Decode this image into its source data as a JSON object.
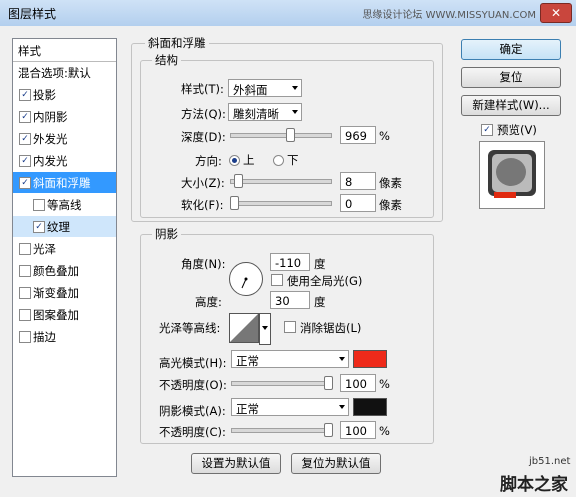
{
  "window": {
    "title": "图层样式",
    "watermark": "思缘设计论坛 WWW.MISSYUAN.COM",
    "close": "✕"
  },
  "sidebar": {
    "header": "样式",
    "items": [
      {
        "label": "混合选项:默认",
        "checkbox": false,
        "checked": false,
        "selected": false,
        "sub": false
      },
      {
        "label": "投影",
        "checkbox": true,
        "checked": true,
        "selected": false,
        "sub": false
      },
      {
        "label": "内阴影",
        "checkbox": true,
        "checked": true,
        "selected": false,
        "sub": false
      },
      {
        "label": "外发光",
        "checkbox": true,
        "checked": true,
        "selected": false,
        "sub": false
      },
      {
        "label": "内发光",
        "checkbox": true,
        "checked": true,
        "selected": false,
        "sub": false
      },
      {
        "label": "斜面和浮雕",
        "checkbox": true,
        "checked": true,
        "selected": true,
        "sub": false
      },
      {
        "label": "等高线",
        "checkbox": true,
        "checked": false,
        "selected": false,
        "sub": true
      },
      {
        "label": "纹理",
        "checkbox": true,
        "checked": true,
        "selected": false,
        "sub": true
      },
      {
        "label": "光泽",
        "checkbox": true,
        "checked": false,
        "selected": false,
        "sub": false
      },
      {
        "label": "颜色叠加",
        "checkbox": true,
        "checked": false,
        "selected": false,
        "sub": false
      },
      {
        "label": "渐变叠加",
        "checkbox": true,
        "checked": false,
        "selected": false,
        "sub": false
      },
      {
        "label": "图案叠加",
        "checkbox": true,
        "checked": false,
        "selected": false,
        "sub": false
      },
      {
        "label": "描边",
        "checkbox": true,
        "checked": false,
        "selected": false,
        "sub": false
      }
    ]
  },
  "bevel": {
    "group_title": "斜面和浮雕",
    "structure_title": "结构",
    "style_label": "样式(T):",
    "style_value": "外斜面",
    "technique_label": "方法(Q):",
    "technique_value": "雕刻清晰",
    "depth_label": "深度(D):",
    "depth_value": "969",
    "depth_unit": "%",
    "direction_label": "方向:",
    "dir_up": "上",
    "dir_down": "下",
    "direction": "up",
    "size_label": "大小(Z):",
    "size_value": "8",
    "size_unit": "像素",
    "soften_label": "软化(F):",
    "soften_value": "0",
    "soften_unit": "像素",
    "depth_level": 0.6,
    "size_level": 0.04,
    "soften_level": 0.0
  },
  "shading": {
    "title": "阴影",
    "angle_label": "角度(N):",
    "angle_value": "-110",
    "angle_unit": "度",
    "global_light_label": "使用全局光(G)",
    "altitude_label": "高度:",
    "altitude_value": "30",
    "altitude_unit": "度",
    "gloss_label": "光泽等高线:",
    "antialias_label": "消除锯齿(L)",
    "highlight_label": "高光模式(H):",
    "highlight_mode": "正常",
    "highlight_color": "#ee2a1a",
    "hl_opacity_label": "不透明度(O):",
    "hl_opacity_value": "100",
    "hl_opacity_unit": "%",
    "shadow_label": "阴影模式(A):",
    "shadow_mode": "正常",
    "shadow_color": "#111111",
    "sh_opacity_label": "不透明度(C):",
    "sh_opacity_value": "100",
    "sh_opacity_unit": "%",
    "hl_opacity_level": 1.0,
    "sh_opacity_level": 1.0
  },
  "footer": {
    "make_default": "设置为默认值",
    "reset_default": "复位为默认值"
  },
  "actions": {
    "ok": "确定",
    "reset": "复位",
    "new_style": "新建样式(W)...",
    "preview_label": "预览(V)"
  },
  "corner_watermark": {
    "domain": "jb51.net",
    "brand": "脚本之家"
  }
}
